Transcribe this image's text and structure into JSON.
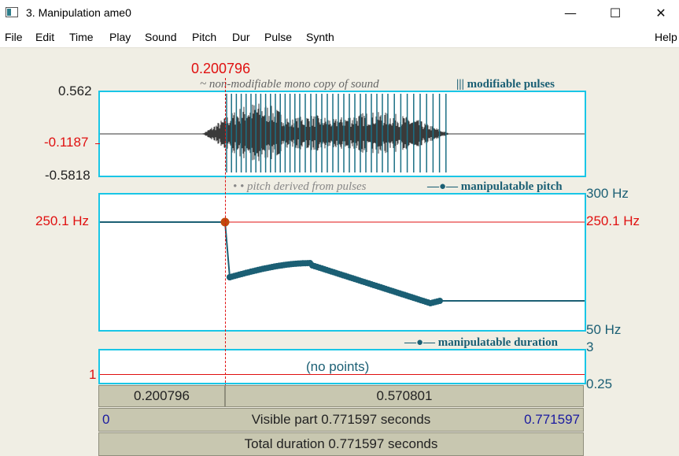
{
  "window": {
    "title": "3. Manipulation ame0",
    "minimize_glyph": "—",
    "maximize_glyph": "☐",
    "close_glyph": "✕"
  },
  "menu": [
    "File",
    "Edit",
    "Time",
    "Play",
    "Sound",
    "Pitch",
    "Dur",
    "Pulse",
    "Synth"
  ],
  "menu_help": "Help",
  "cursor_time": "0.200796",
  "sound": {
    "legend_copy": "~ non-modifiable mono copy of sound",
    "legend_pulses": "||| modifiable pulses",
    "y_max": "0.562",
    "y_cursor": "-0.1187",
    "y_min": "-0.5818"
  },
  "pitch": {
    "legend_derived": "• • pitch derived from pulses",
    "legend_manip": "—●— manipulatable pitch",
    "top_label": "300 Hz",
    "bottom_label": "50 Hz",
    "cursor_left": "250.1 Hz",
    "cursor_right": "250.1 Hz"
  },
  "duration": {
    "legend": "—●— manipulatable duration",
    "top_label": "3",
    "bottom_label": "0.25",
    "one_label": "1",
    "empty_text": "(no points)"
  },
  "bars": {
    "left_time": "0.200796",
    "right_time": "0.570801",
    "visible_start": "0",
    "visible_text": "Visible part 0.771597 seconds",
    "visible_end": "0.771597",
    "total_text": "Total duration 0.771597 seconds"
  },
  "colors": {
    "panel_border": "#19c6e6",
    "cursor": "#e01010",
    "pitch": "#1b5f74",
    "waveform": "#3a3a3a"
  }
}
